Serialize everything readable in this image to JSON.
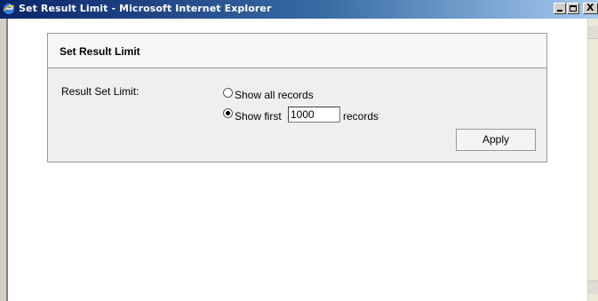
{
  "window": {
    "title": "Set Result Limit - Microsoft Internet Explorer",
    "minimize_glyph": "_",
    "maximize_glyph": "□",
    "close_glyph": "X"
  },
  "panel": {
    "title": "Set Result Limit",
    "field_label": "Result Set Limit:",
    "options": {
      "all_label": "Show all records",
      "first_label": "Show first",
      "records_suffix": "records",
      "selected": "first"
    },
    "limit_value": "1000",
    "apply_label": "Apply"
  }
}
